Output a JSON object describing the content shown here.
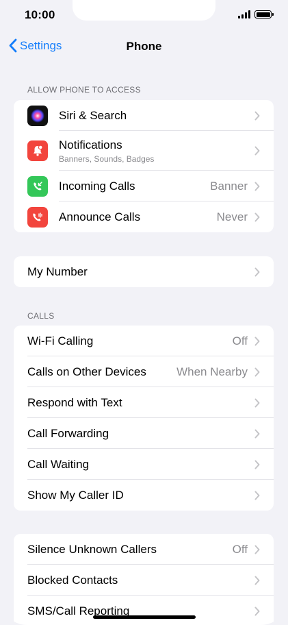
{
  "status": {
    "time": "10:00"
  },
  "nav": {
    "back_label": "Settings",
    "title": "Phone"
  },
  "sections": {
    "allow_header": "ALLOW PHONE TO ACCESS",
    "calls_header": "CALLS"
  },
  "allow_rows": [
    {
      "label": "Siri & Search",
      "icon": "siri-icon",
      "color": "#1c1c3a"
    },
    {
      "label": "Notifications",
      "sublabel": "Banners, Sounds, Badges",
      "icon": "bell-icon",
      "color": "#f2453d"
    },
    {
      "label": "Incoming Calls",
      "value": "Banner",
      "icon": "incoming-call-icon",
      "color": "#34c759"
    },
    {
      "label": "Announce Calls",
      "value": "Never",
      "icon": "announce-call-icon",
      "color": "#f2453d"
    }
  ],
  "my_number": {
    "label": "My Number"
  },
  "calls_rows": [
    {
      "label": "Wi-Fi Calling",
      "value": "Off"
    },
    {
      "label": "Calls on Other Devices",
      "value": "When Nearby"
    },
    {
      "label": "Respond with Text"
    },
    {
      "label": "Call Forwarding"
    },
    {
      "label": "Call Waiting"
    },
    {
      "label": "Show My Caller ID"
    }
  ],
  "more_rows": [
    {
      "label": "Silence Unknown Callers",
      "value": "Off"
    },
    {
      "label": "Blocked Contacts"
    },
    {
      "label": "SMS/Call Reporting"
    }
  ],
  "colors": {
    "accent": "#157efb",
    "background": "#f2f2f7"
  }
}
